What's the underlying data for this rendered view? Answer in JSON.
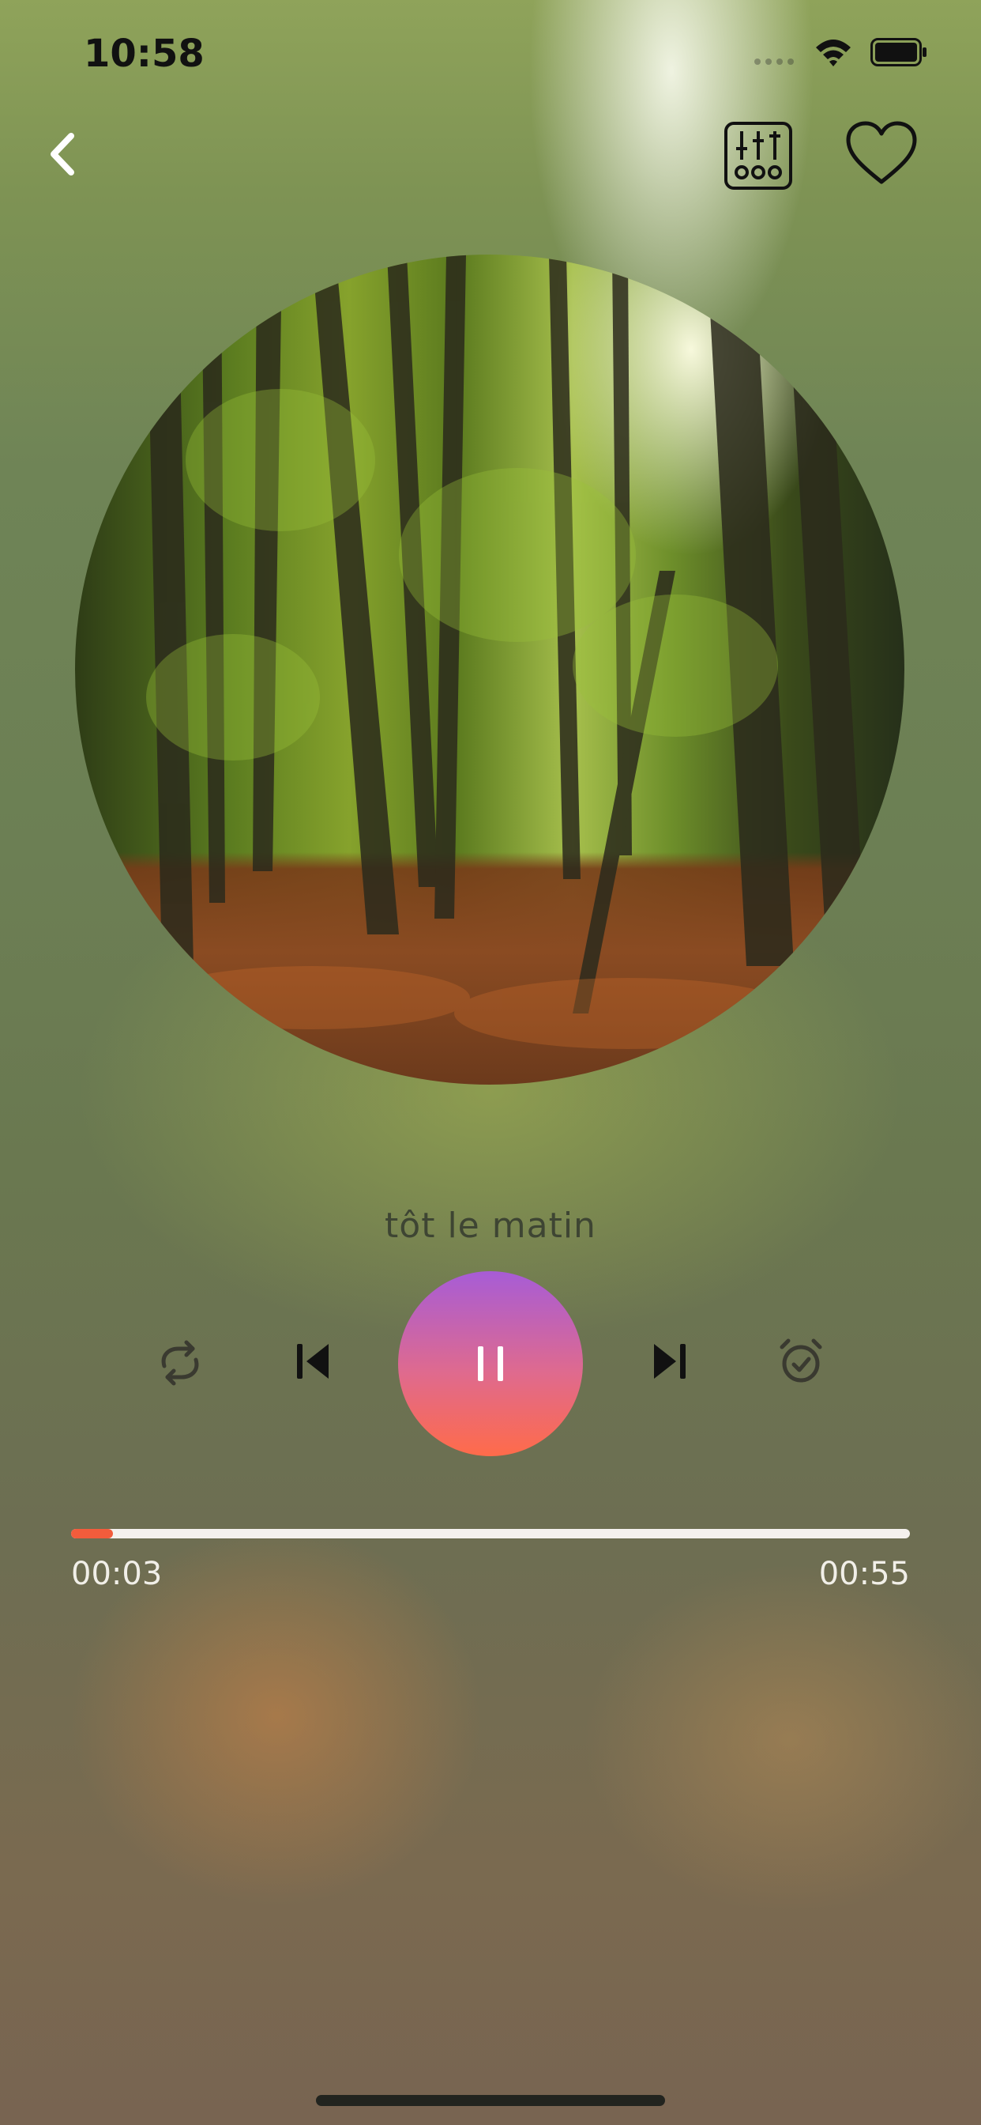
{
  "status_bar": {
    "time": "10:58",
    "icons": [
      "cellular-signal-icon",
      "wifi-icon",
      "battery-icon"
    ]
  },
  "nav": {
    "back_icon": "chevron-left-icon",
    "equalizer_icon": "equalizer-icon",
    "favorite_icon": "heart-outline-icon"
  },
  "now_playing": {
    "title": "tôt le matin",
    "artwork": "forest-artwork"
  },
  "controls": {
    "repeat_icon": "repeat-icon",
    "previous_icon": "skip-previous-icon",
    "play_pause_icon": "pause-icon",
    "next_icon": "skip-next-icon",
    "timer_icon": "alarm-clock-icon"
  },
  "progress": {
    "elapsed": "00:03",
    "total": "00:55",
    "fraction": 0.05
  },
  "colors": {
    "accent": "#f25c3c",
    "play_gradient_top": "#a75cd6",
    "play_gradient_bottom": "#ff6b4a",
    "title_text": "#3e4533"
  }
}
